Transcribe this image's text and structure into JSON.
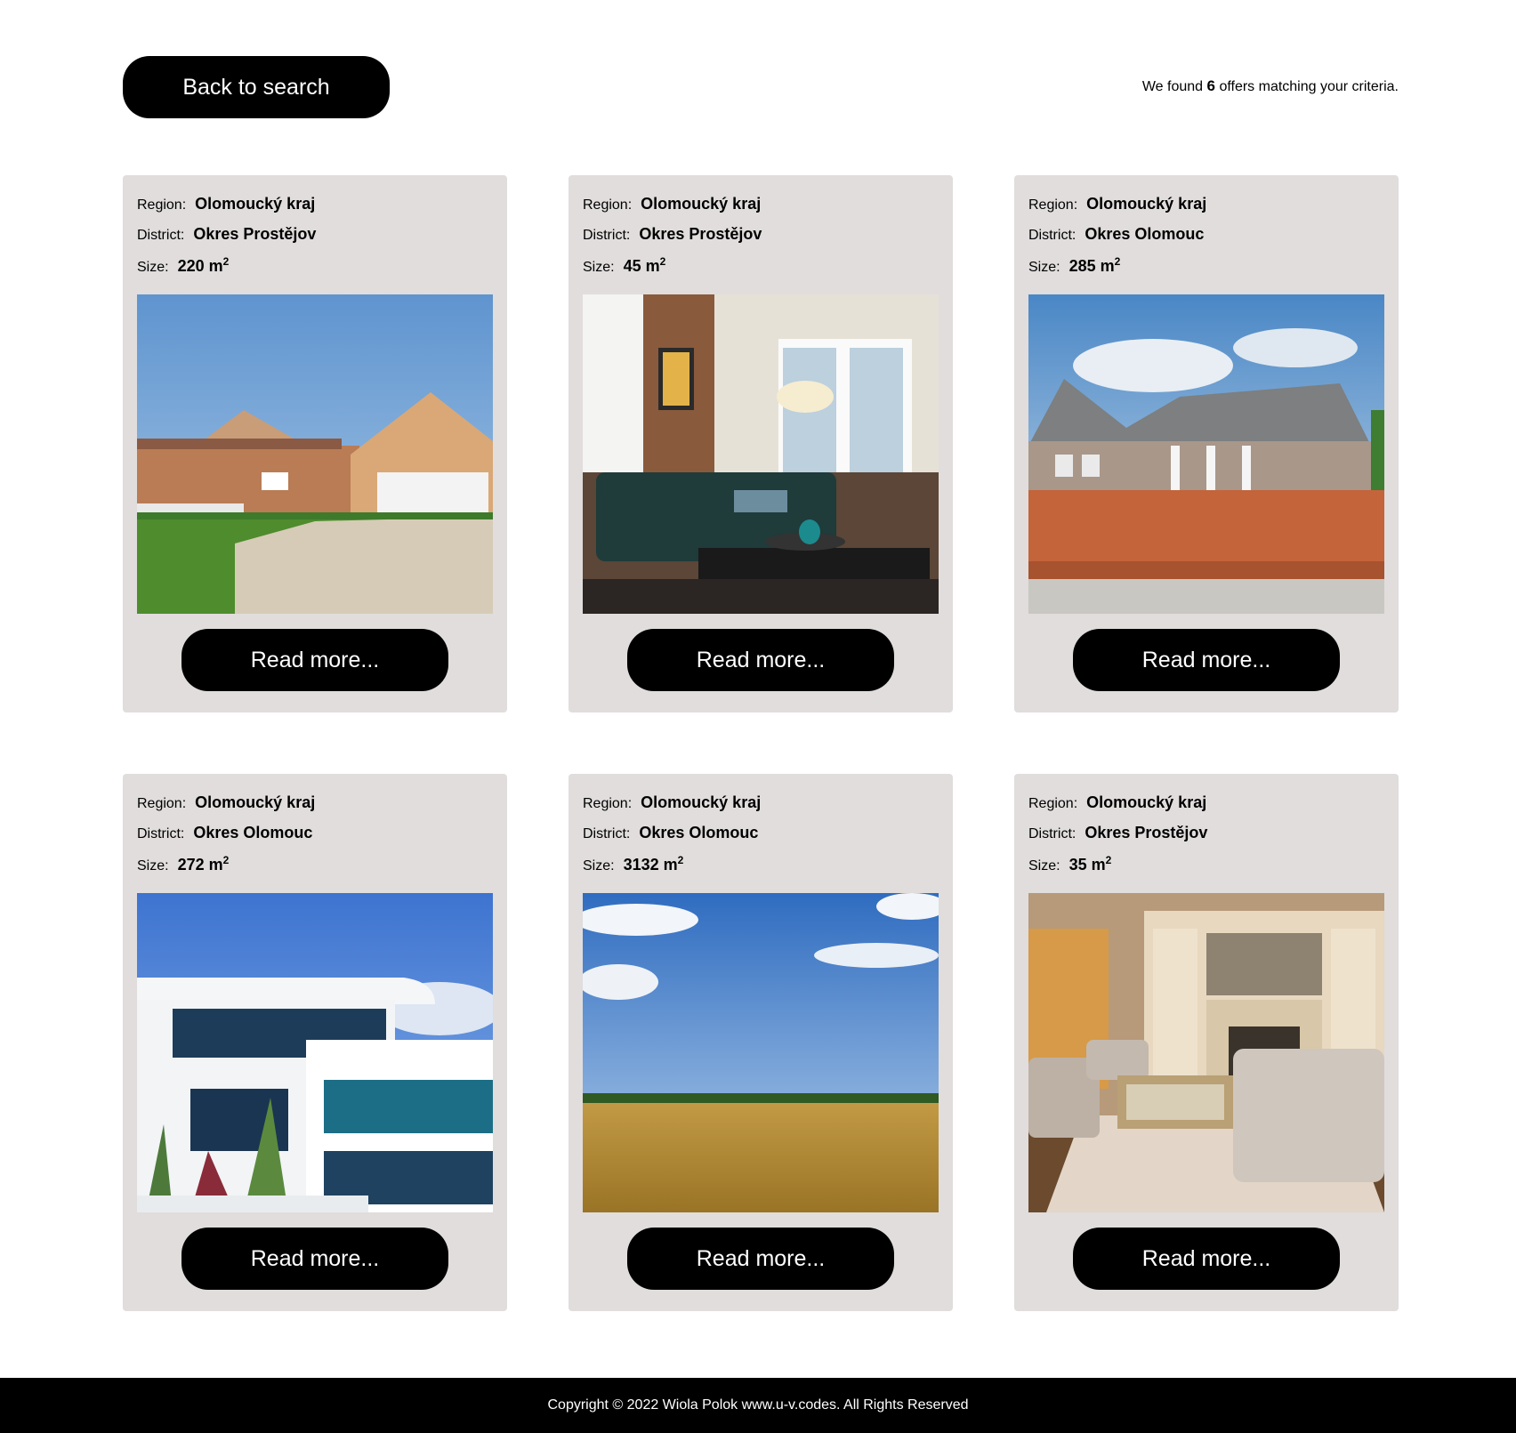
{
  "header": {
    "back_label": "Back to search",
    "results_prefix": "We found",
    "results_count": "6",
    "results_suffix": "offers matching your criteria."
  },
  "labels": {
    "region": "Region:",
    "district": "District:",
    "size": "Size:",
    "unit": "m",
    "unit_exp": "2"
  },
  "offers": [
    {
      "region": "Olomoucký kraj",
      "district": "Okres Prostějov",
      "size": "220",
      "image": "suburban-house-photo",
      "button": "Read more..."
    },
    {
      "region": "Olomoucký kraj",
      "district": "Okres Prostějov",
      "size": "45",
      "image": "living-room-photo",
      "button": "Read more..."
    },
    {
      "region": "Olomoucký kraj",
      "district": "Okres Olomouc",
      "size": "285",
      "image": "new-house-construction-photo",
      "button": "Read more..."
    },
    {
      "region": "Olomoucký kraj",
      "district": "Okres Olomouc",
      "size": "272",
      "image": "modern-villa-photo",
      "button": "Read more..."
    },
    {
      "region": "Olomoucký kraj",
      "district": "Okres Olomouc",
      "size": "3132",
      "image": "field-landscape-photo",
      "button": "Read more..."
    },
    {
      "region": "Olomoucký kraj",
      "district": "Okres Prostějov",
      "size": "35",
      "image": "luxury-living-room-photo",
      "button": "Read more..."
    }
  ],
  "footer": {
    "text": "Copyright © 2022 Wiola Polok www.u-v.codes. All Rights Reserved"
  },
  "colors": {
    "button_bg": "#000000",
    "card_bg": "#e0dddc",
    "footer_bg": "#000000"
  }
}
